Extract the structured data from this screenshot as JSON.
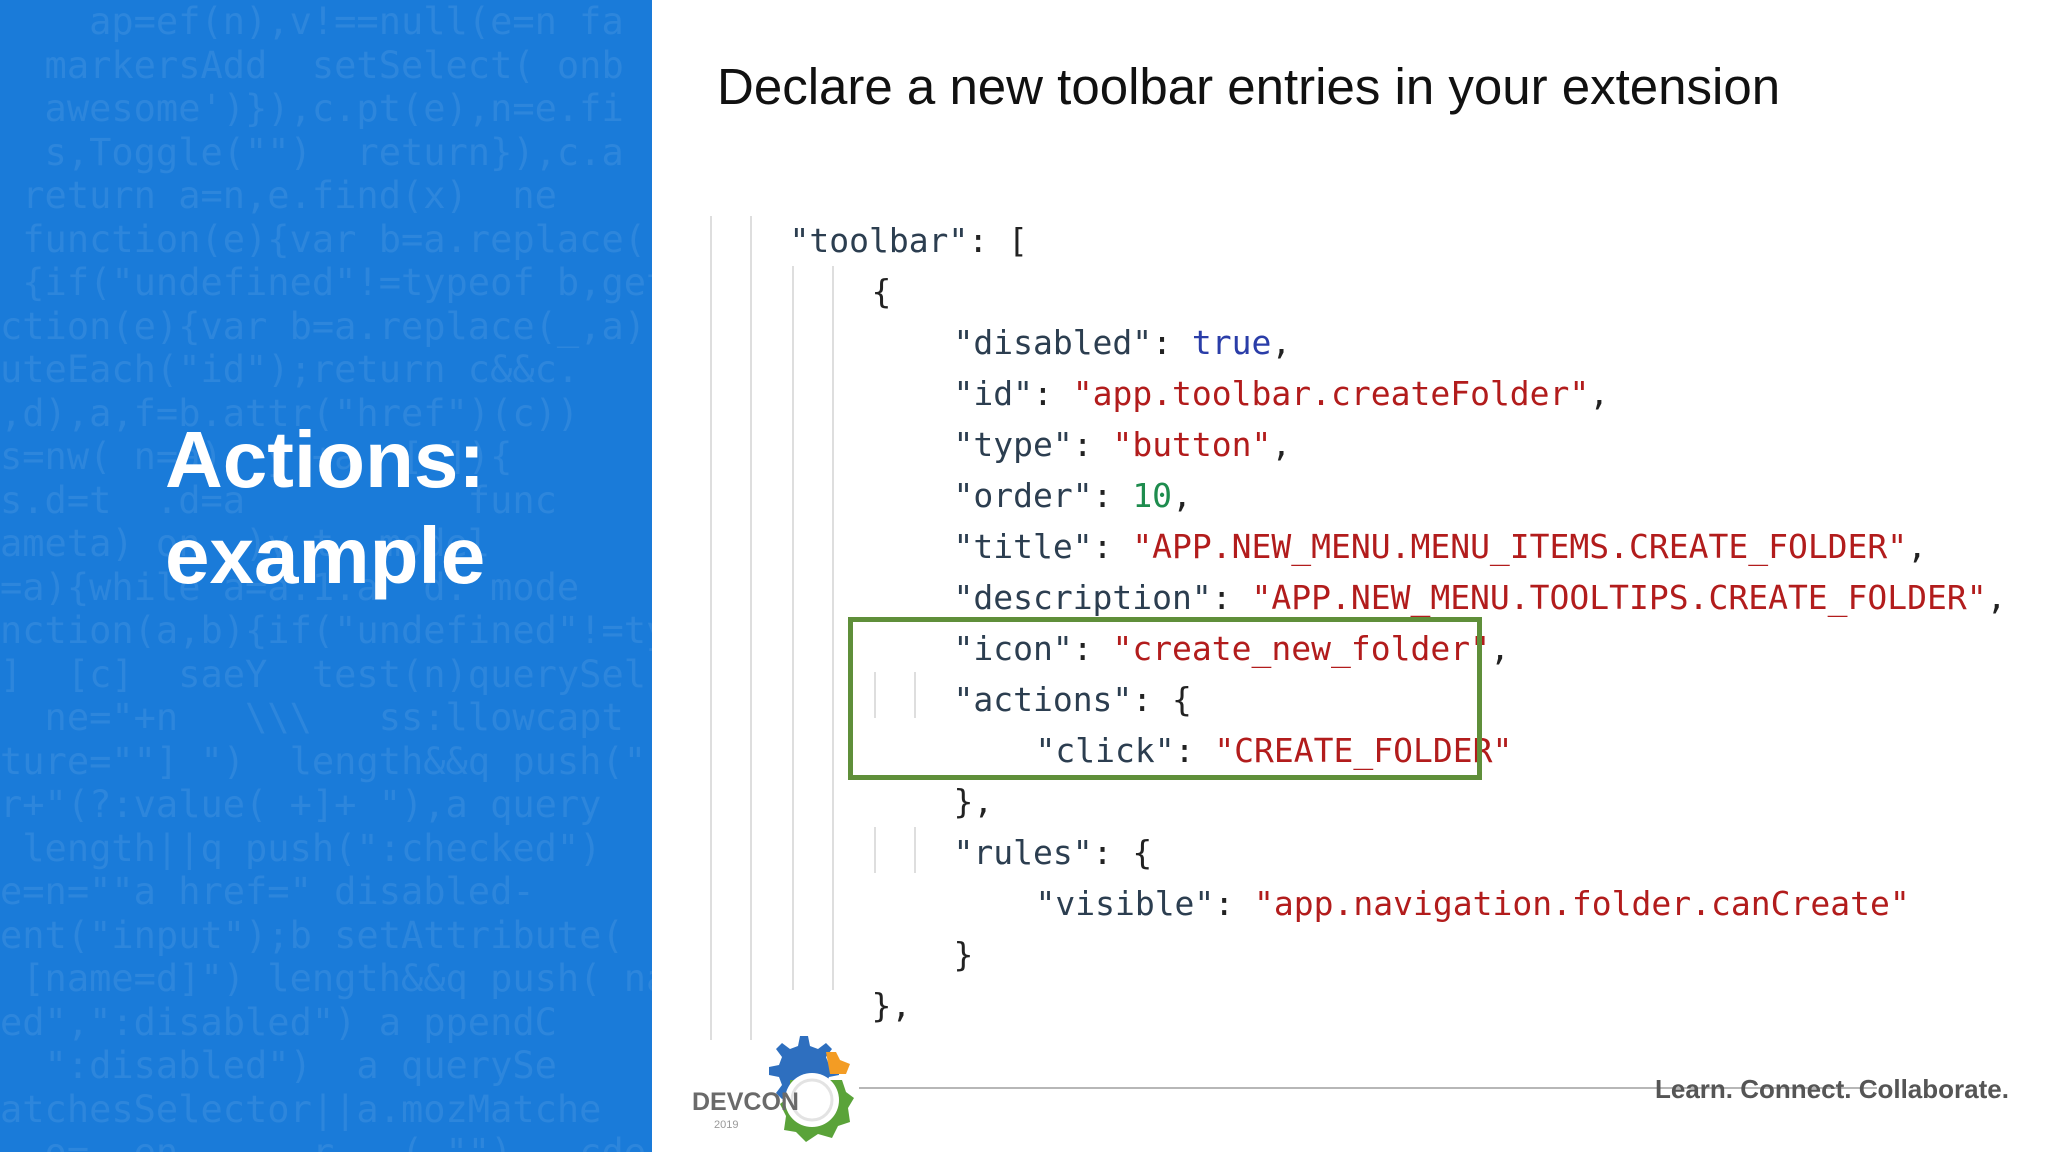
{
  "left_panel": {
    "title_line1": "Actions:",
    "title_line2": "example",
    "bg_code_lines": [
      "    ap=ef(n),v!==null(e=n fa",
      "  markersAdd  setSelect( onb",
      "  awesome')}),c.pt(e),n=e.fi",
      "  s,Toggle(\"\")  return}),c.a",
      " return a=n,e.find(x)  ne",
      " function(e){var b=a.replace(",
      " {if(\"undefined\"!=typeof b,get",
      "ction(e){var b=a.replace(_,a)",
      "uteEach(\"id\");return c&&c.",
      ",d),a,f=b.attr(\"href\")(c))",
      "s=nw( n=a)  y +a  [ ]){",
      "s.d=t  .d=a          func",
      "ameta) on  )y t  model",
      "=a){while a=a.1.a  d. mode",
      "nction(a,b){if(\"undefined\"!=typ",
      "]  [c]  saeY  test(n)querySel",
      "  ne=\"+n   \\\\\\   ss:llowcapt",
      "ture=\"\"] \")  length&&q push(\" [",
      "r+\"(?:value( +]+ \"),a query",
      " length||q push(\":checked\")",
      "e=n=\"\"a href=\" disabled-",
      "ent(\"input\");b setAttribute(",
      " [name=d]\") length&&q push( na",
      "ed\",\":disabled\") a ppendC",
      "  \":disabled\")  a querySe",
      "atchesSelector||a.mozMatche",
      "  o=  en      r   ( \"\"),  cde"
    ]
  },
  "slide": {
    "heading": "Declare a new toolbar entries in your extension"
  },
  "code": {
    "toolbar_key": "\"toolbar\"",
    "open_bracket": ": [",
    "open_brace": "{",
    "disabled_key": "\"disabled\"",
    "disabled_value": "true",
    "id_key": "\"id\"",
    "id_value": "\"app.toolbar.createFolder\"",
    "type_key": "\"type\"",
    "type_value": "\"button\"",
    "order_key": "\"order\"",
    "order_value": "10",
    "title_key": "\"title\"",
    "title_value": "\"APP.NEW_MENU.MENU_ITEMS.CREATE_FOLDER\"",
    "description_key": "\"description\"",
    "description_value": "\"APP.NEW_MENU.TOOLTIPS.CREATE_FOLDER\"",
    "icon_key": "\"icon\"",
    "icon_value": "\"create_new_folder\"",
    "actions_key": "\"actions\"",
    "click_key": "\"click\"",
    "click_value": "\"CREATE_FOLDER\"",
    "rules_key": "\"rules\"",
    "visible_key": "\"visible\"",
    "visible_value": "\"app.navigation.folder.canCreate\"",
    "close_brace_comma": "},",
    "close_brace": "}"
  },
  "footer": {
    "logo_text": "DEVCON",
    "logo_year": "2019",
    "tagline": "Learn. Connect. Collaborate."
  },
  "colors": {
    "panel_blue": "#1a7bd9",
    "highlight_green": "#5f8f3a",
    "string_red": "#b21c1c",
    "keyword_blue": "#2a3da8",
    "number_green": "#1e8c4e"
  }
}
